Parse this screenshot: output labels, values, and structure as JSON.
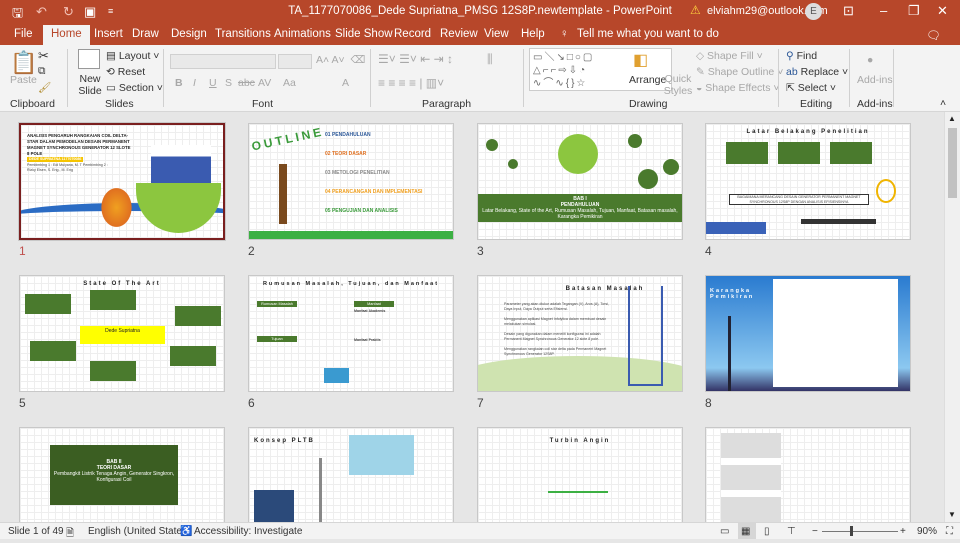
{
  "window": {
    "title": "TA_1177070086_Dede Supriatna_PMSG 12S8P.newtemplate  -  PowerPoint",
    "account": "elviahm29@outlook.com",
    "avatar_initial": "E"
  },
  "tabs": [
    "File",
    "Home",
    "Insert",
    "Draw",
    "Design",
    "Transitions",
    "Animations",
    "Slide Show",
    "Record",
    "Review",
    "View",
    "Help"
  ],
  "active_tab": "Home",
  "tell_me": "Tell me what you want to do",
  "ribbon": {
    "clipboard": {
      "label": "Clipboard",
      "paste": "Paste"
    },
    "slides": {
      "label": "Slides",
      "new_slide": "New Slide",
      "layout": "Layout",
      "reset": "Reset",
      "section": "Section"
    },
    "font": {
      "label": "Font",
      "bold": "B",
      "italic": "I",
      "underline": "U",
      "shadow": "S",
      "strike": "abc",
      "spacing": "AV",
      "case": "Aa",
      "color": "A"
    },
    "paragraph": {
      "label": "Paragraph"
    },
    "drawing": {
      "label": "Drawing",
      "arrange": "Arrange",
      "quick_styles": "Quick Styles",
      "shape_fill": "Shape Fill",
      "shape_outline": "Shape Outline",
      "shape_effects": "Shape Effects"
    },
    "editing": {
      "label": "Editing",
      "find": "Find",
      "replace": "Replace",
      "select": "Select"
    },
    "addins": {
      "label": "Add-ins",
      "button": "Add-ins"
    }
  },
  "slides": [
    {
      "n": "1",
      "title": "ANALISIS PENGARUH RANGKAIAN COIL DELTA-STAR DALAM PEMODELAN DESAIN PERMANENT MAGNET SYNCHRONOUS GENERATOR 12 SLOTE 8 POLE",
      "sub": "DEDE SUPRIATNA 1177070086",
      "body": "Pembimbing 1 : Edi Mulyana, M. T  Pembimbing 2 : Rizky Elsen, S. Eng., M. Eng"
    },
    {
      "n": "2",
      "title": "OUTLINE",
      "items": [
        "01 PENDAHULUAN",
        "02 TEORI DASAR",
        "03 METOLOGI PENELITIAN",
        "04 PERANCANGAN DAN IMPLEMENTASI",
        "05 PENGUJIAN DAN ANALISIS"
      ]
    },
    {
      "n": "3",
      "title": "BAB I",
      "sub": "PENDAHULUAN",
      "body": "Latar Belakang, State of the Art, Rumusan Masalah, Tujuan, Manfaat, Batasan masalah, Karangka Pemikiran"
    },
    {
      "n": "4",
      "title": "Latar Belakang Penelitian",
      "body": "BAGAIMANA MERANCANG DESAIN GENERATOR PERMANENT MAGNET SYNCHRONOUS 12S8P DENGAN ANALISIS EFISIENSINYA"
    },
    {
      "n": "5",
      "title": "State Of The Art",
      "body": "Dede Supriatna"
    },
    {
      "n": "6",
      "title": "Rumusan Masalah, Tujuan, dan Manfaat",
      "items": [
        "Rumusan Masalah",
        "Tujuan",
        "Manfaat",
        "Manfaat Akademis",
        "Manfaat Praktis"
      ]
    },
    {
      "n": "7",
      "title": "Batasan Masalah",
      "items": [
        "Parameter yang akan diukur adalah Tegangan (V), Arus (A), Torsi, Daya Input, Daya Output serta Efisiensi.",
        "Menggunakan aplikasi Magnet Infolytica dalam membuat desain melakukan simulasi.",
        "Desain yang digunakan dalam meneliti konfigurasi ini adalah Permanent Magnet Synchronous Generator 12 slote 8 pole.",
        "Menggunakan rangkaian coil star delta pada Permanent Magnet Synchronous Generator 12S8P."
      ]
    },
    {
      "n": "8",
      "title": "Karangka Pemikiran"
    },
    {
      "n": "9",
      "title": "BAB II",
      "sub": "TEORI DASAR",
      "body": "Pembangkit Listrik Tenaga Angin, Generator Singkron,  Konfigurasi Coil"
    },
    {
      "n": "10",
      "title": "Konsep PLTB"
    },
    {
      "n": "11",
      "title": "Turbin Angin"
    },
    {
      "n": "12",
      "title": ""
    }
  ],
  "status": {
    "slide": "Slide 1 of 49",
    "language": "English (United States)",
    "accessibility": "Accessibility: Investigate",
    "zoom": "90%",
    "zoom_level": 90
  },
  "colors": {
    "accent": "#b7472a",
    "green": "#4a7a2d"
  }
}
